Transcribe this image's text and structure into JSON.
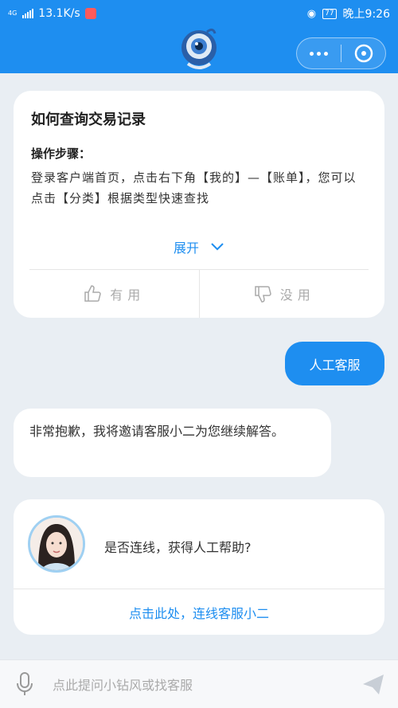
{
  "status_bar": {
    "network": "4G",
    "speed": "13.1K/s",
    "battery": "77",
    "time": "晚上9:26"
  },
  "header": {
    "mascot_icon": "ant-mascot-icon",
    "more_icon": "more-dots-icon",
    "close_icon": "close-target-icon",
    "accent": "#1e8ef0"
  },
  "faq": {
    "title": "如何查询交易记录",
    "subtitle": "操作步骤：",
    "body": "登录客户端首页，点击右下角【我的】—【账单】，您可以点击【分类】根据类型快速查找",
    "expand_label": "展开",
    "useful_label": "有用",
    "useless_label": "没用"
  },
  "user_message": "人工客服",
  "bot_message": "非常抱歉，我将邀请客服小二为您继续解答。",
  "agent_card": {
    "question": "是否连线，获得人工帮助?",
    "link": "点击此处，连线客服小二"
  },
  "input": {
    "placeholder": "点此提问小钻风或找客服"
  }
}
